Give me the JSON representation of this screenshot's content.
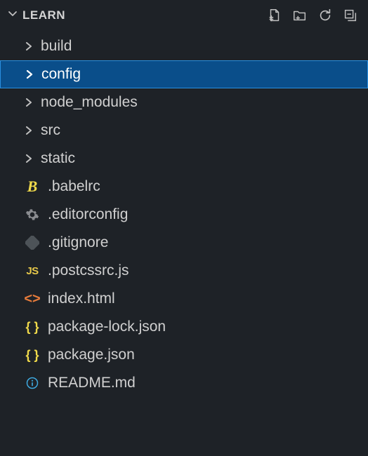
{
  "header": {
    "project": "LEARN"
  },
  "tree": {
    "folders": [
      {
        "name": "build",
        "selected": false
      },
      {
        "name": "config",
        "selected": true
      },
      {
        "name": "node_modules",
        "selected": false
      },
      {
        "name": "src",
        "selected": false
      },
      {
        "name": "static",
        "selected": false
      }
    ],
    "files": [
      {
        "name": ".babelrc",
        "icon": "babel"
      },
      {
        "name": ".editorconfig",
        "icon": "gear"
      },
      {
        "name": ".gitignore",
        "icon": "git"
      },
      {
        "name": ".postcssrc.js",
        "icon": "js"
      },
      {
        "name": "index.html",
        "icon": "html"
      },
      {
        "name": "package-lock.json",
        "icon": "json"
      },
      {
        "name": "package.json",
        "icon": "json"
      },
      {
        "name": "README.md",
        "icon": "info"
      }
    ]
  }
}
